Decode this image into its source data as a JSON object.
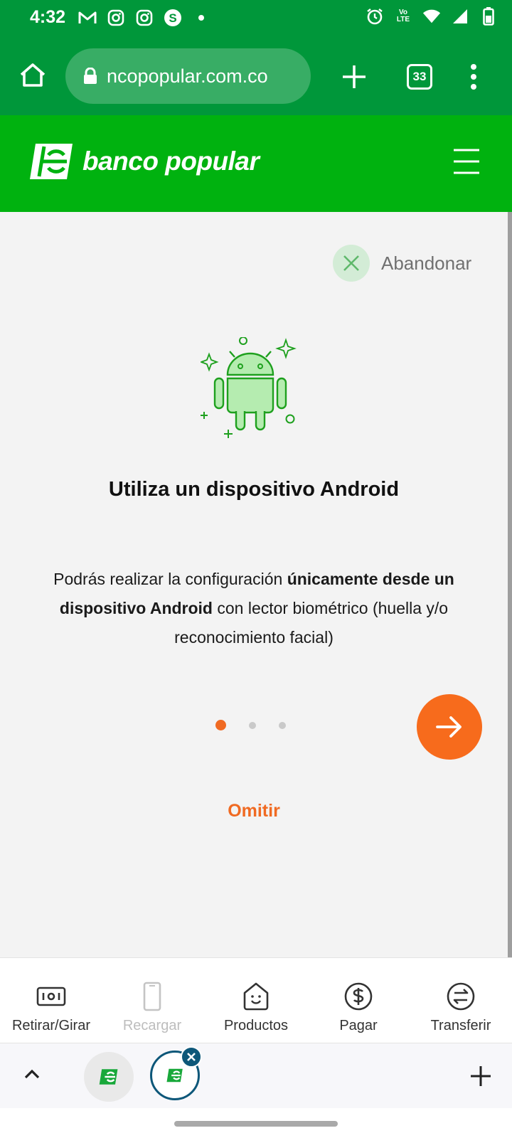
{
  "status_bar": {
    "time": "4:32",
    "left_icons": [
      "gmail-icon",
      "instagram-icon",
      "instagram-icon",
      "skype-icon",
      "dot-icon"
    ],
    "right_icons": [
      "alarm-icon",
      "volte-icon",
      "wifi-icon",
      "signal-icon",
      "battery-icon"
    ],
    "volte_label": "Vo\nLTE"
  },
  "browser": {
    "url": "ncopopular.com.co",
    "tab_count": "33"
  },
  "site": {
    "brand": "banco popular",
    "brand_color": "#00b20f"
  },
  "onboarding": {
    "abandon_label": "Abandonar",
    "title": "Utiliza un dispositivo Android",
    "desc_pre": "Podrás realizar la configuración ",
    "desc_bold1": "únicamente desde un",
    "desc_bold2": "dispositivo Android",
    "desc_post": " con lector biométrico (huella y/o reconocimiento facial)",
    "dots_total": 3,
    "active_dot": 1,
    "skip_label": "Omitir",
    "accent_color": "#f76b1c"
  },
  "bottom_nav": {
    "items": [
      {
        "label": "Retirar/Girar",
        "icon": "cash-icon",
        "enabled": true
      },
      {
        "label": "Recargar",
        "icon": "phone-icon",
        "enabled": false
      },
      {
        "label": "Productos",
        "icon": "bag-icon",
        "enabled": true
      },
      {
        "label": "Pagar",
        "icon": "dollar-icon",
        "enabled": true
      },
      {
        "label": "Transferir",
        "icon": "transfer-icon",
        "enabled": true
      }
    ]
  },
  "tab_strip": {
    "tabs": [
      "banco-popular-tab",
      "banco-popular-tab-active"
    ]
  }
}
